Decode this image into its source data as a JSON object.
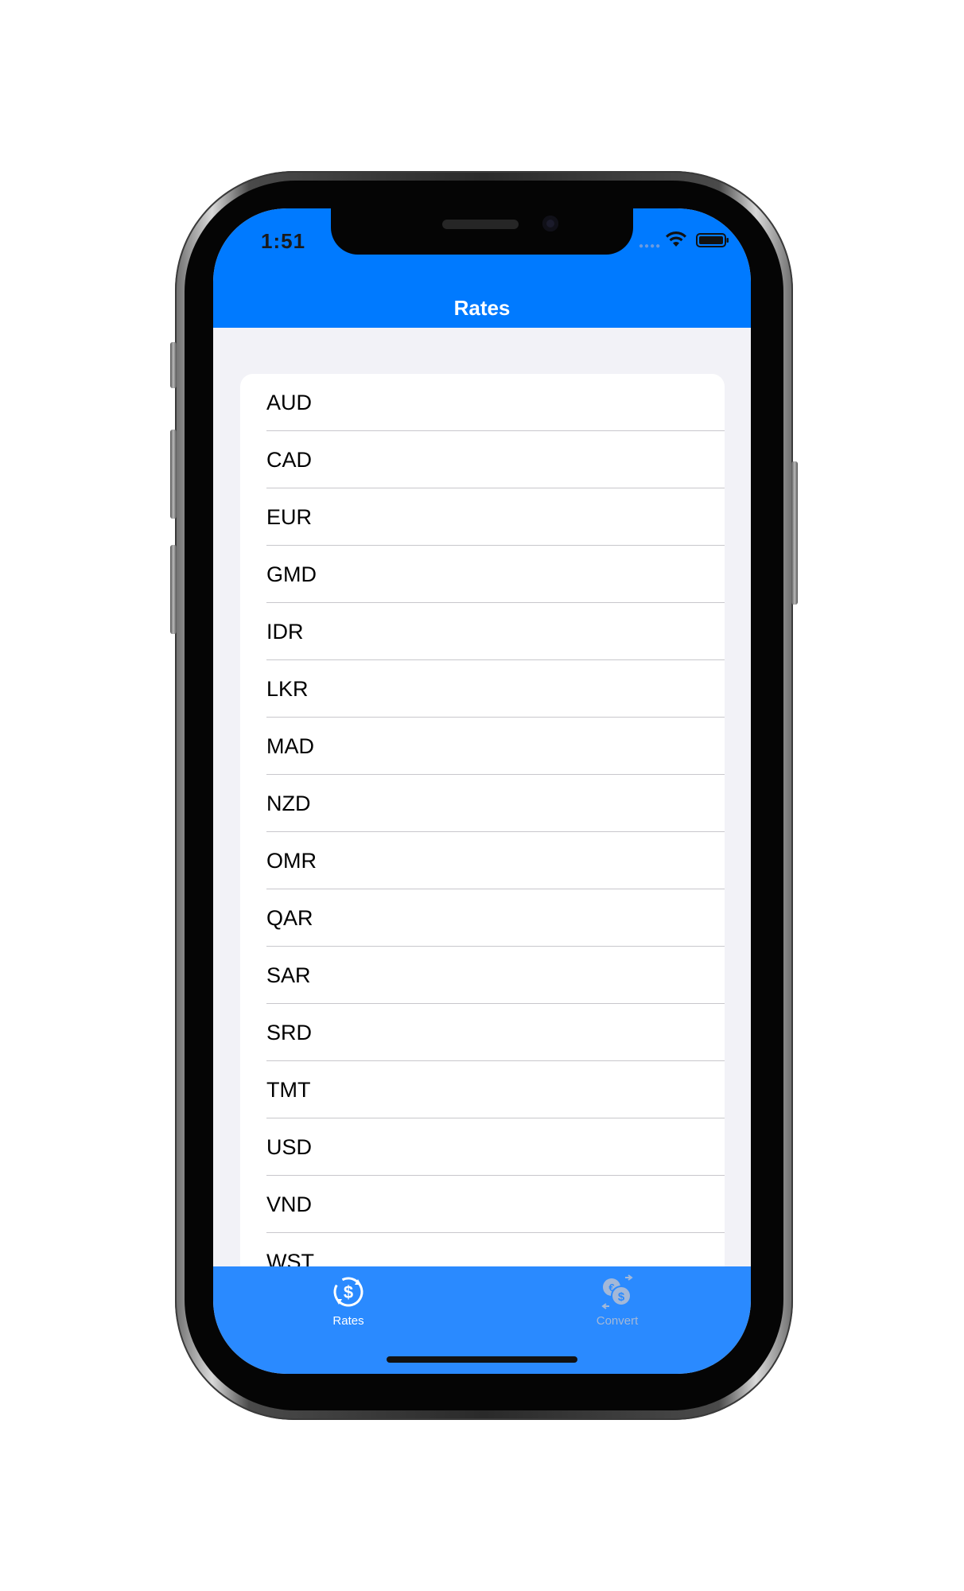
{
  "status_bar": {
    "time": "1:51"
  },
  "nav": {
    "title": "Rates"
  },
  "currencies": [
    "AUD",
    "CAD",
    "EUR",
    "GMD",
    "IDR",
    "LKR",
    "MAD",
    "NZD",
    "OMR",
    "QAR",
    "SAR",
    "SRD",
    "TMT",
    "USD",
    "VND",
    "WST"
  ],
  "tab_bar": {
    "tabs": [
      {
        "label": "Rates",
        "icon": "rates-exchange-icon",
        "selected": true
      },
      {
        "label": "Convert",
        "icon": "convert-coins-icon",
        "selected": false
      }
    ]
  },
  "colors": {
    "accent": "#007aff",
    "tab_bar": "#2a8aff",
    "background": "#f2f2f7",
    "inactive_tab": "#a3b8d8"
  }
}
